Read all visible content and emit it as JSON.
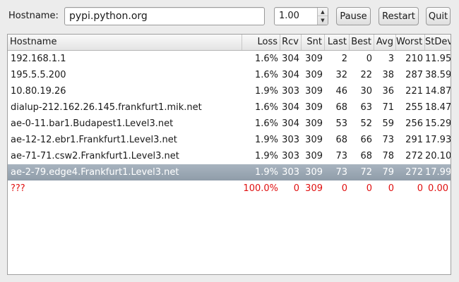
{
  "toolbar": {
    "hostname_label": "Hostname:",
    "hostname_value": "pypi.python.org",
    "interval_value": "1.00",
    "pause_label": "Pause",
    "restart_label": "Restart",
    "quit_label": "Quit"
  },
  "table": {
    "columns": [
      "Hostname",
      "Loss",
      "Rcv",
      "Snt",
      "Last",
      "Best",
      "Avg",
      "Worst",
      "StDev"
    ],
    "rows": [
      {
        "host": "192.168.1.1",
        "loss": "1.6%",
        "rcv": "304",
        "snt": "309",
        "last": "2",
        "best": "0",
        "avg": "3",
        "worst": "210",
        "stdev": "11.95"
      },
      {
        "host": "195.5.5.200",
        "loss": "1.6%",
        "rcv": "304",
        "snt": "309",
        "last": "32",
        "best": "22",
        "avg": "38",
        "worst": "287",
        "stdev": "38.59"
      },
      {
        "host": "10.80.19.26",
        "loss": "1.9%",
        "rcv": "303",
        "snt": "309",
        "last": "46",
        "best": "30",
        "avg": "36",
        "worst": "221",
        "stdev": "14.87"
      },
      {
        "host": "dialup-212.162.26.145.frankfurt1.mik.net",
        "loss": "1.6%",
        "rcv": "304",
        "snt": "309",
        "last": "68",
        "best": "63",
        "avg": "71",
        "worst": "255",
        "stdev": "18.47"
      },
      {
        "host": "ae-0-11.bar1.Budapest1.Level3.net",
        "loss": "1.6%",
        "rcv": "304",
        "snt": "309",
        "last": "53",
        "best": "52",
        "avg": "59",
        "worst": "256",
        "stdev": "15.29"
      },
      {
        "host": "ae-12-12.ebr1.Frankfurt1.Level3.net",
        "loss": "1.9%",
        "rcv": "303",
        "snt": "309",
        "last": "68",
        "best": "66",
        "avg": "73",
        "worst": "291",
        "stdev": "17.93"
      },
      {
        "host": "ae-71-71.csw2.Frankfurt1.Level3.net",
        "loss": "1.9%",
        "rcv": "303",
        "snt": "309",
        "last": "73",
        "best": "68",
        "avg": "78",
        "worst": "272",
        "stdev": "20.10"
      },
      {
        "host": "ae-2-79.edge4.Frankfurt1.Level3.net",
        "loss": "1.9%",
        "rcv": "303",
        "snt": "309",
        "last": "73",
        "best": "72",
        "avg": "79",
        "worst": "272",
        "stdev": "17.99"
      },
      {
        "host": "???",
        "loss": "100.0%",
        "rcv": "0",
        "snt": "309",
        "last": "0",
        "best": "0",
        "avg": "0",
        "worst": "0",
        "stdev": "0.00"
      }
    ]
  },
  "selected_row_host": "ae-2-79.edge4.Frankfurt1.Level3.net",
  "colors": {
    "selected_row": "#9aa6b2",
    "error_text": "#e01010"
  },
  "icons": {
    "spin_up": "spin-up-arrow-icon",
    "spin_down": "spin-down-arrow-icon"
  }
}
